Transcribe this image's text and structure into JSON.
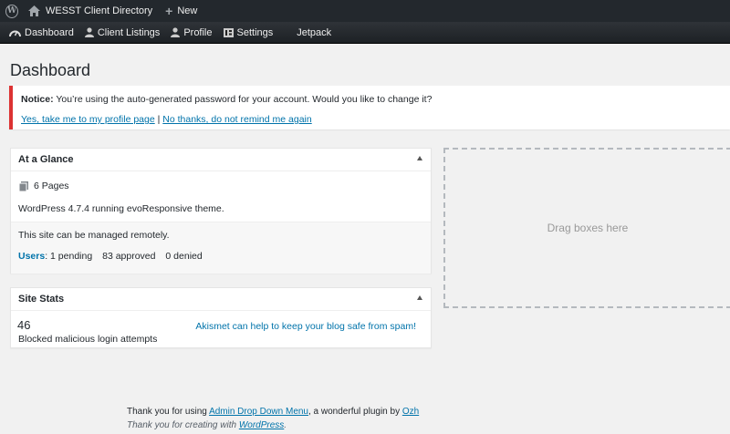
{
  "admin_bar": {
    "site_name": "WESST Client Directory",
    "new_label": "New"
  },
  "menu": {
    "items": [
      {
        "label": "Dashboard",
        "icon": "dashboard-icon"
      },
      {
        "label": "Client Listings",
        "icon": "user-icon"
      },
      {
        "label": "Profile",
        "icon": "user-icon"
      },
      {
        "label": "Settings",
        "icon": "settings-icon"
      },
      {
        "label": "Jetpack",
        "icon": ""
      }
    ]
  },
  "page": {
    "title": "Dashboard"
  },
  "notice": {
    "strong": "Notice:",
    "message": " You’re using the auto-generated password for your account. Would you like to change it?",
    "link_yes": "Yes, take me to my profile page",
    "separator": "|",
    "link_no": "No thanks, do not remind me again"
  },
  "at_a_glance": {
    "title": "At a Glance",
    "pages": "6 Pages",
    "version_text": "WordPress 4.7.4 running evoResponsive theme.",
    "remote_text": "This site can be managed remotely.",
    "users_label": "Users",
    "users_colon": ":",
    "pending": "1 pending",
    "approved": "83 approved",
    "denied": "0 denied"
  },
  "site_stats": {
    "title": "Site Stats",
    "blocked_count": "46",
    "blocked_label": "Blocked malicious login attempts",
    "akismet_link": "Akismet can help to keep your blog safe from spam!"
  },
  "drop_zone": {
    "label": "Drag boxes here"
  },
  "footer": {
    "line1_prefix": "Thank you for using ",
    "plugin_link": "Admin Drop Down Menu",
    "line1_middle": ", a wonderful plugin by ",
    "author_link": "Ozh",
    "line2_prefix": "Thank you for creating with ",
    "wp_link": "WordPress",
    "line2_suffix": "."
  },
  "colors": {
    "admin_bar_bg": "#23282d",
    "link": "#0073aa",
    "notice_border": "#dc3232",
    "page_bg": "#f1f1f1"
  }
}
